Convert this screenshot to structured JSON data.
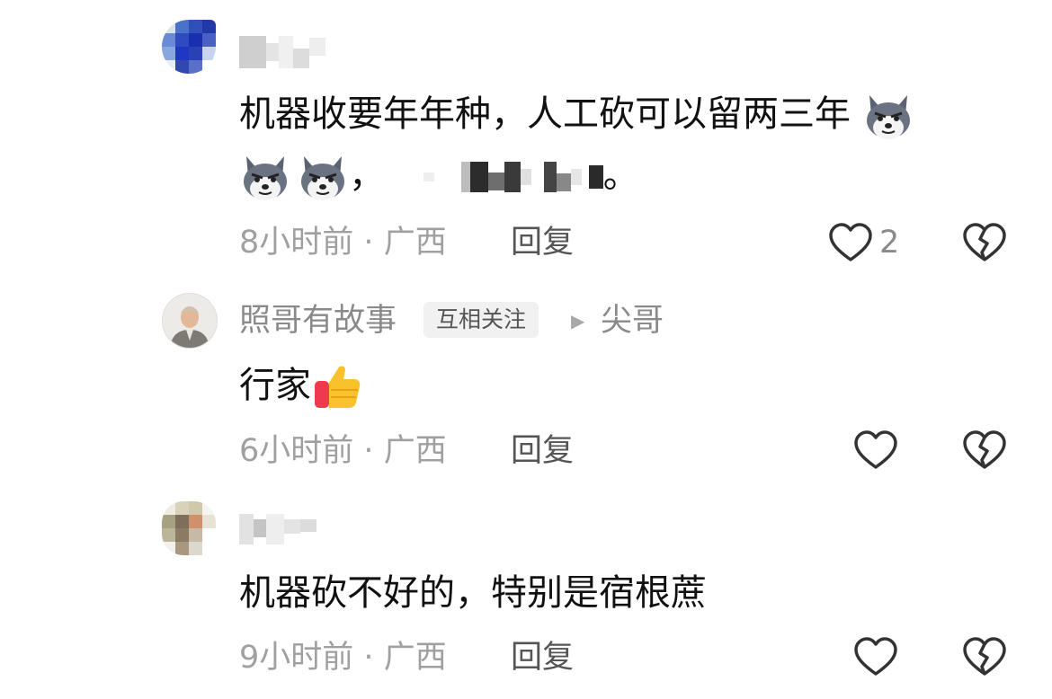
{
  "comments": [
    {
      "text_line1": "机器收要年年种，人工砍可以留两三年",
      "text_line2_punct": "，",
      "text_line2_end": "。",
      "time": "8小时前",
      "sep": "·",
      "location": "广西",
      "reply_label": "回复",
      "likes": "2",
      "emoji": "husky-dog-emoji"
    },
    {
      "author": "照哥有故事",
      "badge": "互相关注",
      "reply_to": "尖哥",
      "text": "行家",
      "emoji": "thumbs-up-emoji",
      "time": "6小时前",
      "sep": "·",
      "location": "广西",
      "reply_label": "回复"
    },
    {
      "text": "机器砍不好的，特别是宿根蔗",
      "time": "9小时前",
      "sep": "·",
      "location": "广西",
      "reply_label": "回复"
    }
  ],
  "colors": {
    "text": "#111111",
    "meta": "#a0a0a0",
    "icon": "#333333",
    "badge_bg": "#f1f1f1"
  }
}
